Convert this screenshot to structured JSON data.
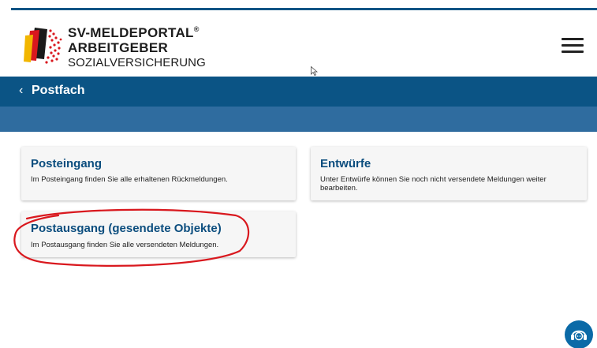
{
  "header": {
    "brand_line1": "SV-MELDEPORTAL",
    "brand_reg": "®",
    "brand_line2": "ARBEITGEBER",
    "brand_line3": "SOZIALVERSICHERUNG",
    "menu_icon": "hamburger-menu-icon"
  },
  "navbar": {
    "back_symbol": "‹",
    "title": "Postfach"
  },
  "cards": [
    {
      "title": "Posteingang",
      "description": "Im Posteingang finden Sie alle erhaltenen Rückmeldungen."
    },
    {
      "title": "Entwürfe",
      "description": "Unter Entwürfe können Sie noch nicht versendete Meldungen weiter bearbeiten."
    },
    {
      "title": "Postausgang (gesendete Objekte)",
      "description": "Im Postausgang finden Sie alle versendeten Meldungen."
    }
  ],
  "colors": {
    "primary": "#0b5485",
    "secondary_bar": "#2f6c9f",
    "annotation": "#d9181e",
    "help_button": "#0b6aa7"
  },
  "help": {
    "icon": "support-headset-icon"
  }
}
